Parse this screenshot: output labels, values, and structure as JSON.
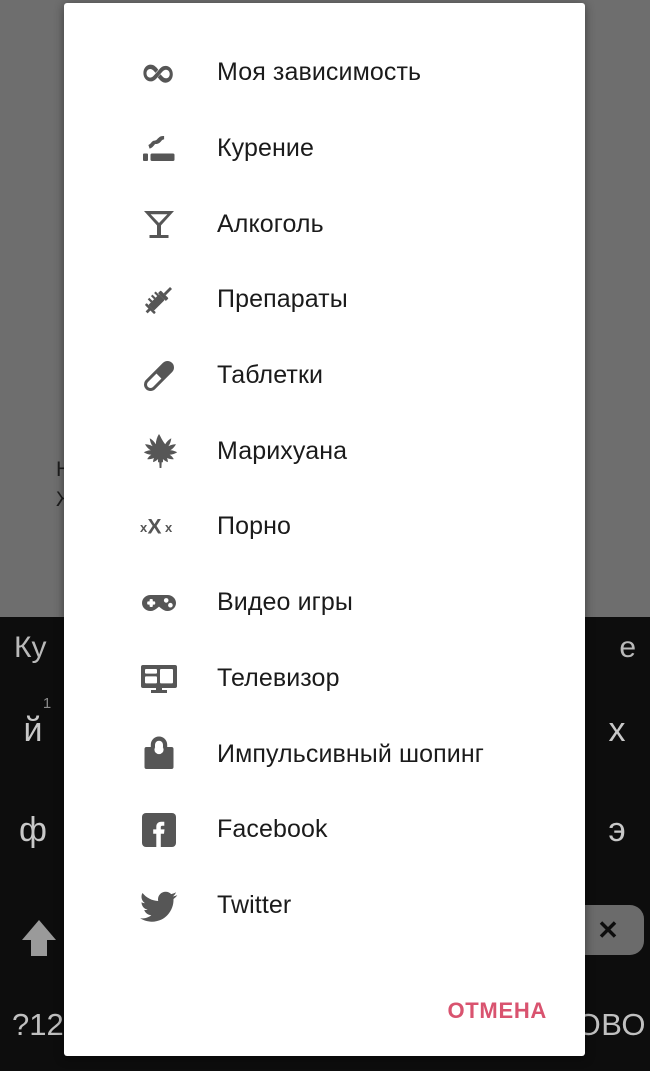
{
  "background": {
    "app_text_line1": "Н",
    "app_text_line2": "Ж",
    "keyboard": {
      "suggestion_left": "Ку",
      "suggestion_right": "е",
      "row1_left_key": "й",
      "row1_left_key_number": "1",
      "row1_right_key": "х",
      "row2_left_key": "ф",
      "row2_right_key": "э",
      "shift_key": "shift-arrow-up-icon",
      "backspace_key": "backspace-icon",
      "symbols_key": "?12",
      "done_key": "ТОВО"
    }
  },
  "dialog": {
    "items": [
      {
        "label": "Моя зависимость",
        "icon": "infinity-icon"
      },
      {
        "label": "Курение",
        "icon": "cigarette-icon"
      },
      {
        "label": "Алкоголь",
        "icon": "cocktail-glass-icon"
      },
      {
        "label": "Препараты",
        "icon": "syringe-icon"
      },
      {
        "label": "Таблетки",
        "icon": "pill-capsule-icon"
      },
      {
        "label": "Марихуана",
        "icon": "cannabis-leaf-icon"
      },
      {
        "label": "Порно",
        "icon": "xxx-icon"
      },
      {
        "label": "Видео игры",
        "icon": "gamepad-icon"
      },
      {
        "label": "Телевизор",
        "icon": "television-icon"
      },
      {
        "label": "Импульсивный шопинг",
        "icon": "shopping-bag-icon"
      },
      {
        "label": "Facebook",
        "icon": "facebook-icon"
      },
      {
        "label": "Twitter",
        "icon": "twitter-bird-icon"
      }
    ],
    "cancel_label": "ОТМЕНА",
    "colors": {
      "cancel": "#d9536f",
      "icon": "#565656",
      "label": "#1b1b1b",
      "surface": "#ffffff",
      "scrim": "#6e6e6e"
    }
  }
}
